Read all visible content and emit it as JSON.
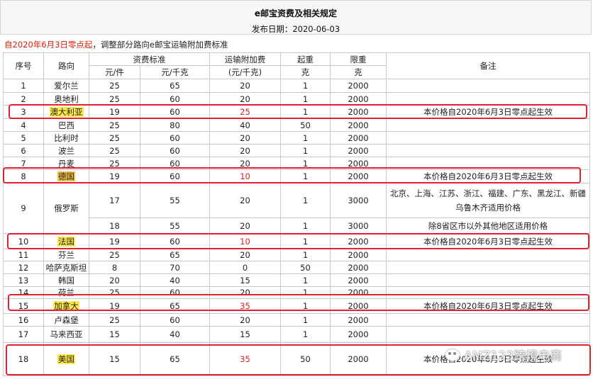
{
  "header": {
    "title": "e邮宝资费及相关规定",
    "date": "发布日期：2020-06-03"
  },
  "note": {
    "red": "自2020年6月3日零点起",
    "rest": "，调整部分路向e邮宝运输附加费标准"
  },
  "columns": {
    "seq": "序号",
    "route": "路向",
    "tariff": "资费标准",
    "surcharge": "运输附加费",
    "min": "起重",
    "limit": "限重",
    "remark": "备注",
    "per_item": "元/件",
    "per_kg": "元/千克",
    "surcharge_unit": "(元/千克)",
    "gram": "克",
    "gram2": "克"
  },
  "rows": [
    {
      "no": "1",
      "route": "爱尔兰",
      "per_item": "25",
      "per_kg": "65",
      "surcharge": "20",
      "min": "1",
      "limit": "2000",
      "remark": ""
    },
    {
      "no": "2",
      "route": "奥地利",
      "per_item": "25",
      "per_kg": "60",
      "surcharge": "20",
      "min": "1",
      "limit": "2000",
      "remark": ""
    },
    {
      "no": "3",
      "route": "澳大利亚",
      "per_item": "19",
      "per_kg": "60",
      "surcharge": "25",
      "min": "1",
      "limit": "2000",
      "remark": "本价格自2020年6月3日零点起生效"
    },
    {
      "no": "4",
      "route": "巴西",
      "per_item": "25",
      "per_kg": "80",
      "surcharge": "40",
      "min": "50",
      "limit": "2000",
      "remark": ""
    },
    {
      "no": "5",
      "route": "比利时",
      "per_item": "25",
      "per_kg": "60",
      "surcharge": "20",
      "min": "1",
      "limit": "2000",
      "remark": ""
    },
    {
      "no": "6",
      "route": "波兰",
      "per_item": "25",
      "per_kg": "60",
      "surcharge": "20",
      "min": "1",
      "limit": "2000",
      "remark": ""
    },
    {
      "no": "7",
      "route": "丹麦",
      "per_item": "25",
      "per_kg": "60",
      "surcharge": "20",
      "min": "1",
      "limit": "2000",
      "remark": ""
    },
    {
      "no": "8",
      "route": "德国",
      "per_item": "19",
      "per_kg": "60",
      "surcharge": "10",
      "min": "1",
      "limit": "2000",
      "remark": "本价格自2020年6月3日零点起生效"
    },
    {
      "no": "9",
      "route": "俄罗斯",
      "a": {
        "per_item": "17",
        "per_kg": "55",
        "surcharge": "20",
        "min": "1",
        "limit": "3000",
        "remark": "北京、上海、江苏、浙江、福建、广东、黑龙江、新疆乌鲁木齐适用价格"
      },
      "b": {
        "per_item": "18",
        "per_kg": "55",
        "surcharge": "20",
        "min": "1",
        "limit": "3000",
        "remark": "除8省区市以外其他地区适用价格"
      }
    },
    {
      "no": "10",
      "route": "法国",
      "per_item": "19",
      "per_kg": "60",
      "surcharge": "10",
      "min": "1",
      "limit": "2000",
      "remark": "本价格自2020年6月3日零点起生效"
    },
    {
      "no": "11",
      "route": "芬兰",
      "per_item": "25",
      "per_kg": "65",
      "surcharge": "20",
      "min": "1",
      "limit": "2000",
      "remark": ""
    },
    {
      "no": "12",
      "route": "哈萨克斯坦",
      "per_item": "8",
      "per_kg": "70",
      "surcharge": "0",
      "min": "50",
      "limit": "2000",
      "remark": ""
    },
    {
      "no": "13",
      "route": "韩国",
      "per_item": "20",
      "per_kg": "40",
      "surcharge": "15",
      "min": "1",
      "limit": "2000",
      "remark": ""
    },
    {
      "no": "14",
      "route": "荷兰",
      "per_item": "25",
      "per_kg": "60",
      "surcharge": "20",
      "min": "1",
      "limit": "2000",
      "remark": ""
    },
    {
      "no": "15",
      "route": "加拿大",
      "per_item": "19",
      "per_kg": "65",
      "surcharge": "35",
      "min": "1",
      "limit": "2000",
      "remark": "本价格自2020年6月3日零点起生效"
    },
    {
      "no": "16",
      "route": "卢森堡",
      "per_item": "25",
      "per_kg": "60",
      "surcharge": "20",
      "min": "1",
      "limit": "2000",
      "remark": ""
    },
    {
      "no": "17",
      "route": "马来西亚",
      "per_item": "15",
      "per_kg": "40",
      "surcharge": "15",
      "min": "1",
      "limit": "2000",
      "remark": ""
    },
    {
      "no": "18",
      "route": "美国",
      "per_item": "15",
      "per_kg": "65",
      "surcharge": "35",
      "min": "50",
      "limit": "2000",
      "remark": "本价格自2020年6月3日零点起生效"
    }
  ],
  "watermark": "AMZ123跨境电商",
  "colors": {
    "accent_red": "#d81e06",
    "highlight": "#ffe94a",
    "box": "#e1232f"
  }
}
